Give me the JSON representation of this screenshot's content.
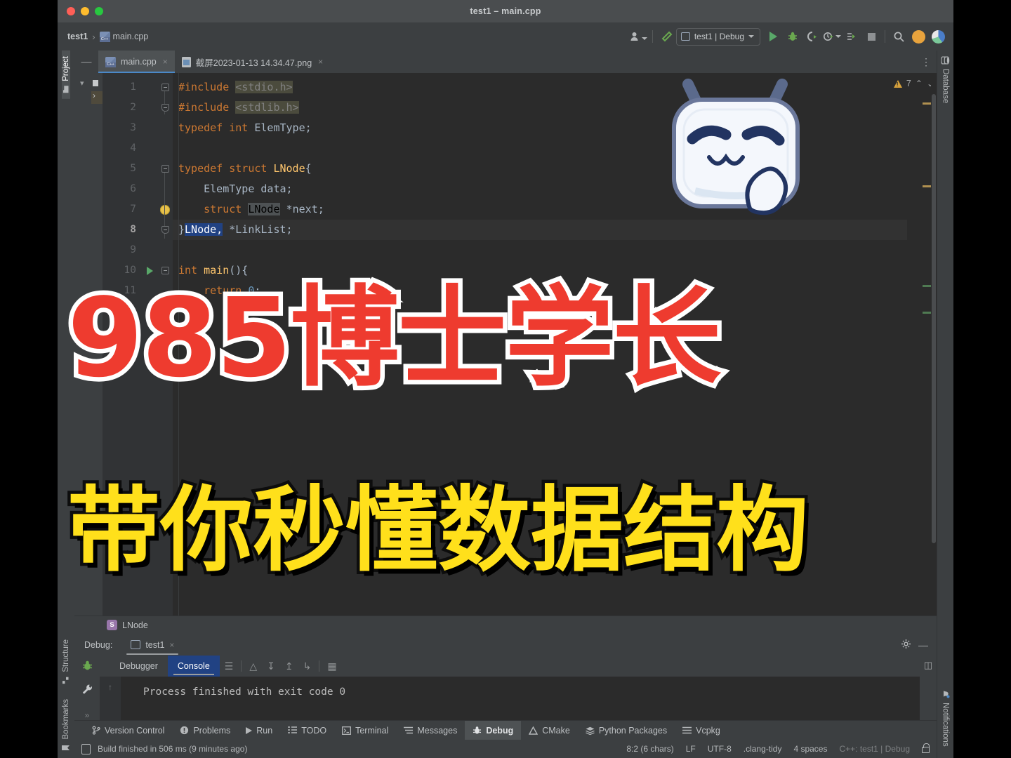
{
  "window": {
    "title": "test1 – main.cpp",
    "traffic_lights": [
      "close",
      "minimize",
      "maximize"
    ]
  },
  "breadcrumb": {
    "project": "test1",
    "separator": "›",
    "file": "main.cpp"
  },
  "toolbar": {
    "user_icon": "user-icon",
    "build_icon": "hammer-icon",
    "run_config": "test1 | Debug",
    "run_icon": "run-icon",
    "debug_icon": "debug-icon",
    "run_coverage_icon": "run-with-coverage-icon",
    "profile_icon": "profiler-icon",
    "attach_icon": "attach-process-icon",
    "stop_icon": "stop-icon",
    "search_icon": "search-icon",
    "updates_icon": "update-icon",
    "ai_icon": "ai-assistant-icon",
    "more_icon": "more-options-icon"
  },
  "left_rail": [
    {
      "label": "Project",
      "icon": "project-icon",
      "selected": true
    },
    {
      "label": "Structure",
      "icon": "structure-icon",
      "selected": false
    },
    {
      "label": "Bookmarks",
      "icon": "bookmarks-icon",
      "selected": false
    }
  ],
  "right_rail": [
    {
      "label": "Database",
      "icon": "database-icon"
    },
    {
      "label": "Notifications",
      "icon": "notifications-icon"
    }
  ],
  "file_tabs": [
    {
      "label": "main.cpp",
      "icon": "cpp-file-icon",
      "active": true,
      "close": "×"
    },
    {
      "label": "截屏2023-01-13 14.34.47.png",
      "icon": "png-file-icon",
      "active": false,
      "close": "×"
    }
  ],
  "editor": {
    "lines": [
      {
        "n": "1",
        "fold": "start",
        "marker": "",
        "current": false
      },
      {
        "n": "2",
        "fold": "end",
        "marker": "",
        "current": false
      },
      {
        "n": "3",
        "fold": "",
        "marker": "",
        "current": false
      },
      {
        "n": "4",
        "fold": "",
        "marker": "",
        "current": false
      },
      {
        "n": "5",
        "fold": "start",
        "marker": "",
        "current": false
      },
      {
        "n": "6",
        "fold": "",
        "marker": "",
        "current": false
      },
      {
        "n": "7",
        "fold": "bulb",
        "marker": "",
        "current": false
      },
      {
        "n": "8",
        "fold": "end",
        "marker": "",
        "current": true
      },
      {
        "n": "9",
        "fold": "",
        "marker": "",
        "current": false
      },
      {
        "n": "10",
        "fold": "start",
        "marker": "run",
        "current": false
      },
      {
        "n": "11",
        "fold": "",
        "marker": "",
        "current": false
      }
    ],
    "code": [
      "#include <stdio.h>",
      "#include <stdlib.h>",
      "typedef int ElemType;",
      "",
      "typedef struct LNode{",
      "    ElemType data;",
      "    struct LNode *next;",
      "}LNode, *LinkList;",
      "",
      "int main(){",
      "    return 0;"
    ],
    "selected_text": "LNode,",
    "breadcrumb": "LNode",
    "breadcrumb_icon": "struct-icon",
    "inspections": {
      "count": "7",
      "icon": "warning-icon",
      "up": "⌃",
      "down": "⌄"
    }
  },
  "debug": {
    "label": "Debug:",
    "session_tab": "test1",
    "session_close": "×",
    "settings_icon": "gear-icon",
    "minimize_icon": "minimize-icon",
    "tabs": [
      {
        "label": "Debugger",
        "selected": false
      },
      {
        "label": "Console",
        "selected": true
      }
    ],
    "tools": [
      "soft-wrap-icon",
      "scroll-up-icon",
      "scroll-down-icon",
      "scroll-top-icon",
      "scroll-end-icon",
      "print-icon"
    ],
    "rail_icons": [
      "debug-bug-icon",
      "wrench-icon",
      "expand-icon"
    ],
    "console_output": "Process finished with exit code 0",
    "console_scroll_icon": "↑",
    "right_icon": "layout-icon"
  },
  "bottom_tools": [
    {
      "label": "Version Control",
      "icon": "branch-icon",
      "selected": false
    },
    {
      "label": "Problems",
      "icon": "problems-icon",
      "selected": false
    },
    {
      "label": "Run",
      "icon": "run-icon",
      "selected": false
    },
    {
      "label": "TODO",
      "icon": "todo-icon",
      "selected": false
    },
    {
      "label": "Terminal",
      "icon": "terminal-icon",
      "selected": false
    },
    {
      "label": "Messages",
      "icon": "messages-icon",
      "selected": false
    },
    {
      "label": "Debug",
      "icon": "debug-bug-icon",
      "selected": true
    },
    {
      "label": "CMake",
      "icon": "cmake-icon",
      "selected": false
    },
    {
      "label": "Python Packages",
      "icon": "python-packages-icon",
      "selected": false
    },
    {
      "label": "Vcpkg",
      "icon": "vcpkg-icon",
      "selected": false
    }
  ],
  "status_bar": {
    "build_icon": "build-icon",
    "build_message": "Build finished in 506 ms (9 minutes ago)",
    "caret": "8:2 (6 chars)",
    "line_sep": "LF",
    "encoding": "UTF-8",
    "inspector": ".clang-tidy",
    "indent": "4 spaces",
    "config": "C++: test1 | Debug",
    "lock_icon": "lock-icon"
  },
  "overlay": {
    "line1": "985博士学长",
    "line2": "带你秒懂数据结构",
    "line1_color": "#ee3b2f",
    "line1_stroke": "#ffffff",
    "line2_color": "#ffe01b",
    "line2_stroke": "#0d0d0d",
    "mascot": "bilibili-mascot-sticker"
  }
}
